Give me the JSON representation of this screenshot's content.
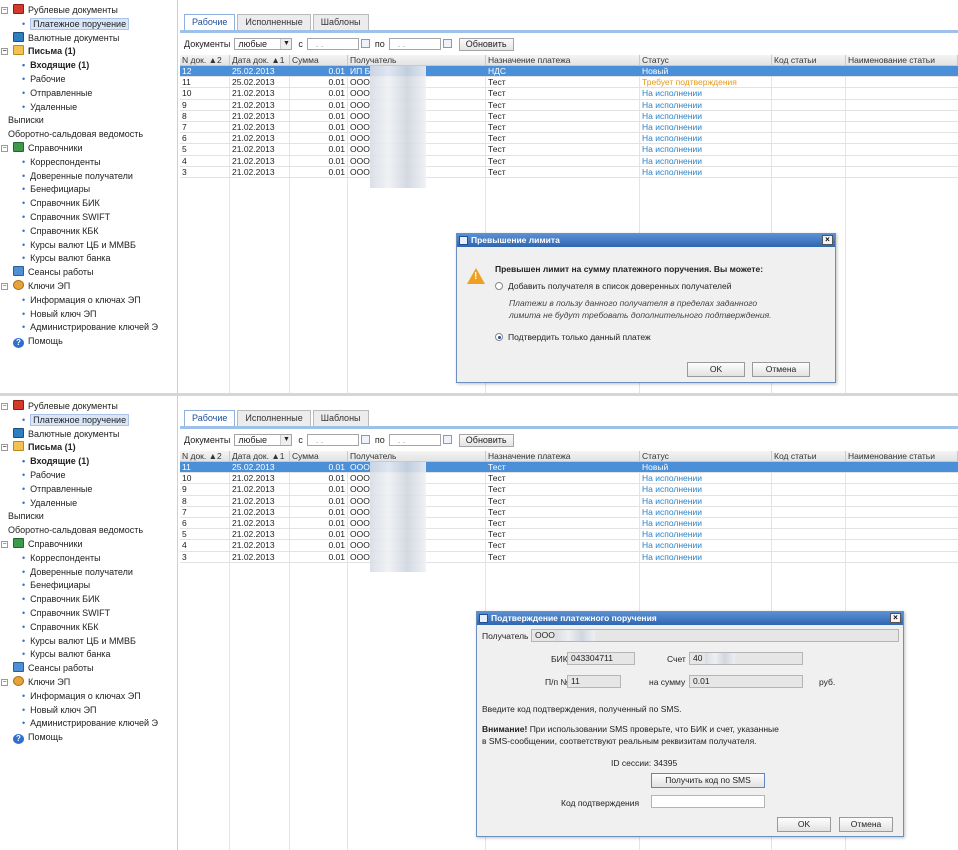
{
  "sidebar": {
    "items": [
      {
        "label": "Рублевые документы",
        "level": 0,
        "icon": "docs",
        "expander": "−"
      },
      {
        "label": "Платежное поручение",
        "level": 1,
        "selected": true
      },
      {
        "label": "Валютные документы",
        "level": 0,
        "icon": "money"
      },
      {
        "label": "Письма (1)",
        "level": 0,
        "icon": "folder",
        "expander": "−",
        "bold": true
      },
      {
        "label": "Входящие (1)",
        "level": 1,
        "bold": true
      },
      {
        "label": "Рабочие",
        "level": 1
      },
      {
        "label": "Отправленные",
        "level": 1
      },
      {
        "label": "Удаленные",
        "level": 1
      },
      {
        "label": "Выписки",
        "level": 0
      },
      {
        "label": "Оборотно-сальдовая ведомость",
        "level": 0
      },
      {
        "label": "Справочники",
        "level": 0,
        "icon": "book",
        "expander": "−"
      },
      {
        "label": "Корреспонденты",
        "level": 1
      },
      {
        "label": "Доверенные получатели",
        "level": 1
      },
      {
        "label": "Бенефициары",
        "level": 1
      },
      {
        "label": "Справочник БИК",
        "level": 1
      },
      {
        "label": "Справочник SWIFT",
        "level": 1
      },
      {
        "label": "Справочник КБК",
        "level": 1
      },
      {
        "label": "Курсы валют ЦБ и ММВБ",
        "level": 1
      },
      {
        "label": "Курсы валют банка",
        "level": 1
      },
      {
        "label": "Сеансы работы",
        "level": 0,
        "icon": "session"
      },
      {
        "label": "Ключи ЭП",
        "level": 0,
        "icon": "key",
        "expander": "−"
      },
      {
        "label": "Информация о ключах ЭП",
        "level": 1
      },
      {
        "label": "Новый ключ ЭП",
        "level": 1
      },
      {
        "label": "Администрирование ключей Э",
        "level": 1
      },
      {
        "label": "Помощь",
        "level": 0,
        "icon": "help"
      }
    ]
  },
  "tabs": [
    "Рабочие",
    "Исполненные",
    "Шаблоны"
  ],
  "filter": {
    "docs_label": "Документы",
    "docs_value": "любые",
    "from_label": "с",
    "to_label": "по",
    "date_placeholder": ". .",
    "refresh": "Обновить"
  },
  "columns": [
    "N док. ▲2",
    "Дата док. ▲1",
    "Сумма",
    "Получатель",
    "Назначение платежа",
    "Статус",
    "Код статьи",
    "Наименование статьи"
  ],
  "top_rows": [
    {
      "num": "12",
      "date": "25.02.2013",
      "sum": "0.01",
      "recipient": "ИП Б",
      "purpose": "НДС",
      "status": "Новый",
      "st": "new",
      "selected": true
    },
    {
      "num": "11",
      "date": "25.02.2013",
      "sum": "0.01",
      "recipient": "ООО",
      "purpose": "Тест",
      "status": "Требует подтверждения",
      "st": "warn"
    },
    {
      "num": "10",
      "date": "21.02.2013",
      "sum": "0.01",
      "recipient": "ООО",
      "purpose": "Тест",
      "status": "На исполнении",
      "st": "ok"
    },
    {
      "num": "9",
      "date": "21.02.2013",
      "sum": "0.01",
      "recipient": "ООО",
      "purpose": "Тест",
      "status": "На исполнении",
      "st": "ok"
    },
    {
      "num": "8",
      "date": "21.02.2013",
      "sum": "0.01",
      "recipient": "ООО",
      "purpose": "Тест",
      "status": "На исполнении",
      "st": "ok"
    },
    {
      "num": "7",
      "date": "21.02.2013",
      "sum": "0.01",
      "recipient": "ООО",
      "purpose": "Тест",
      "status": "На исполнении",
      "st": "ok"
    },
    {
      "num": "6",
      "date": "21.02.2013",
      "sum": "0.01",
      "recipient": "ООО",
      "purpose": "Тест",
      "status": "На исполнении",
      "st": "ok"
    },
    {
      "num": "5",
      "date": "21.02.2013",
      "sum": "0.01",
      "recipient": "ООО",
      "purpose": "Тест",
      "status": "На исполнении",
      "st": "ok"
    },
    {
      "num": "4",
      "date": "21.02.2013",
      "sum": "0.01",
      "recipient": "ООО",
      "purpose": "Тест",
      "status": "На исполнении",
      "st": "ok"
    },
    {
      "num": "3",
      "date": "21.02.2013",
      "sum": "0.01",
      "recipient": "ООО",
      "purpose": "Тест",
      "status": "На исполнении",
      "st": "ok"
    }
  ],
  "bottom_columns": [
    "N док. ▲2",
    "Дата док. ▲1",
    "Сумма",
    "Получатель",
    "Назначение платежа",
    "Статус",
    "Код статьи",
    "Наименование статьи"
  ],
  "bottom_rows": [
    {
      "num": "11",
      "date": "25.02.2013",
      "sum": "0.01",
      "recipient": "ООО",
      "purpose": "Тест",
      "status": "Новый",
      "st": "new",
      "selected": true
    },
    {
      "num": "10",
      "date": "21.02.2013",
      "sum": "0.01",
      "recipient": "ООО",
      "purpose": "Тест",
      "status": "На исполнении",
      "st": "ok"
    },
    {
      "num": "9",
      "date": "21.02.2013",
      "sum": "0.01",
      "recipient": "ООО",
      "purpose": "Тест",
      "status": "На исполнении",
      "st": "ok"
    },
    {
      "num": "8",
      "date": "21.02.2013",
      "sum": "0.01",
      "recipient": "ООО",
      "purpose": "Тест",
      "status": "На исполнении",
      "st": "ok"
    },
    {
      "num": "7",
      "date": "21.02.2013",
      "sum": "0.01",
      "recipient": "ООО",
      "purpose": "Тест",
      "status": "На исполнении",
      "st": "ok"
    },
    {
      "num": "6",
      "date": "21.02.2013",
      "sum": "0.01",
      "recipient": "ООО",
      "purpose": "Тест",
      "status": "На исполнении",
      "st": "ok"
    },
    {
      "num": "5",
      "date": "21.02.2013",
      "sum": "0.01",
      "recipient": "ООО",
      "purpose": "Тест",
      "status": "На исполнении",
      "st": "ok"
    },
    {
      "num": "4",
      "date": "21.02.2013",
      "sum": "0.01",
      "recipient": "ООО",
      "purpose": "Тест",
      "status": "На исполнении",
      "st": "ok"
    },
    {
      "num": "3",
      "date": "21.02.2013",
      "sum": "0.01",
      "recipient": "ООО",
      "purpose": "Тест",
      "status": "На исполнении",
      "st": "ok"
    }
  ],
  "limit_dialog": {
    "title": "Превышение лимита",
    "heading": "Превышен лимит на сумму платежного поручения. Вы можете:",
    "option1": "Добавить получателя в список доверенных получателей",
    "note1": "Платежи в пользу данного получателя в пределах заданного",
    "note2": "лимита не будут требовать дополнительного подтверждения.",
    "option2": "Подтвердить только данный платеж",
    "ok": "OK",
    "cancel": "Отмена"
  },
  "confirm_dialog": {
    "title": "Подтверждение платежного поручения",
    "recipient_label": "Получатель",
    "recipient_value": "ООО",
    "bik_label": "БИК",
    "bik_value": "043304711",
    "account_label": "Счет",
    "account_value": "40",
    "num_label": "П/п №",
    "num_value": "11",
    "sum_label": "на сумму",
    "sum_value": "0.01",
    "currency": "руб.",
    "instruction": "Введите код подтверждения, полученный по SMS.",
    "warning_bold": "Внимание!",
    "warning_line1": " При использовании SMS проверьте, что БИК и счет, указанные",
    "warning_line2": "в SMS-сообщении, соответствуют реальным реквизитам получателя.",
    "session_label": "ID сессии:",
    "session_value": "34395",
    "sms_button": "Получить код по SMS",
    "code_label": "Код подтверждения",
    "ok": "OK",
    "cancel": "Отмена"
  },
  "colors": {
    "status_ok": "#2b82c7",
    "status_warn": "#e39a1c",
    "selection": "#4a8fd8",
    "title_bar": "#2f66b0"
  }
}
